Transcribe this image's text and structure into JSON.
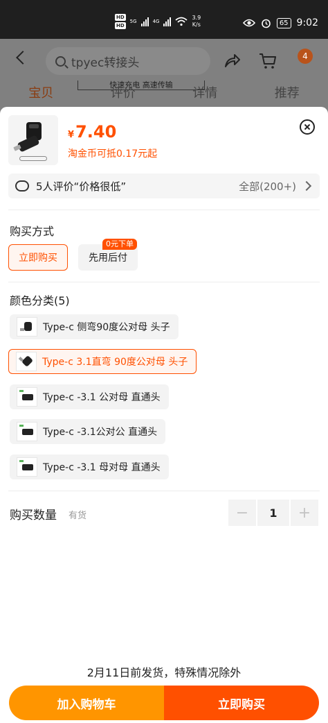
{
  "status_bar": {
    "hd1": "HD",
    "hd2": "HD",
    "net1": "5G",
    "net2": "4G",
    "speed_value": "3.9",
    "speed_unit": "K/s",
    "battery": "65",
    "time": "9:02"
  },
  "background": {
    "search_placeholder": "tpyec转接头",
    "cart_badge": "4",
    "banner": "快速充电 高速传输",
    "tabs": [
      "宝贝",
      "评价",
      "详情",
      "推荐"
    ]
  },
  "product": {
    "currency": "¥",
    "price": "7.40",
    "coin_note": "淘金币可抵0.17元起"
  },
  "reviews": {
    "summary": "5人评价“价格很低”",
    "all_label": "全部(200+)"
  },
  "purchase_method": {
    "title": "购买方式",
    "options": [
      "立即购买",
      "先用后付"
    ],
    "selected_index": 0,
    "promo_tag": "0元下单"
  },
  "color": {
    "title": "颜色分类(5)",
    "options": [
      "Type-c 侧弯90度公对母 头子",
      "Type-c 3.1直弯 90度公对母 头子",
      "Type-c -3.1 公对母 直通头",
      "Type-c -3.1公对公 直通头",
      "Type-c -3.1 母对母 直通头"
    ],
    "selected_index": 1
  },
  "quantity": {
    "label": "购买数量",
    "stock": "有货",
    "value": "1",
    "minus": "−",
    "plus": "+"
  },
  "footer": {
    "ship_note": "2月11日前发货，特殊情况除外",
    "add_cart": "加入购物车",
    "buy_now": "立即购买"
  },
  "colors": {
    "accent": "#ff5000",
    "cart_button": "#ff9500"
  }
}
